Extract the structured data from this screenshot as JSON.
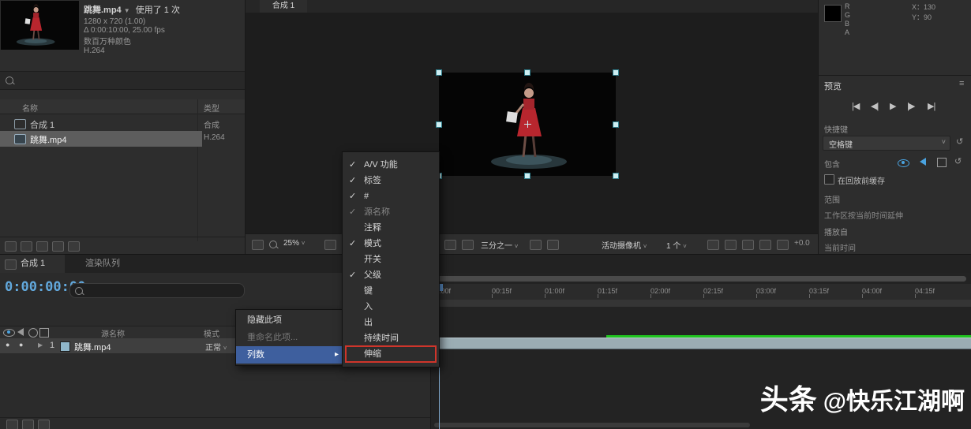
{
  "icons": {
    "check": "✓",
    "chevron_down": "˅",
    "dropdown_caret": "▼",
    "submenu_arrow": "▸",
    "panel_menu": "≡",
    "reset": "↺",
    "expander": "▶",
    "eye_dot": "●",
    "play": "▶",
    "to_start": "|◀",
    "step_back": "◀|",
    "step_fwd": "|▶",
    "to_end": "▶|"
  },
  "project": {
    "clip_name": "跳舞.mp4",
    "usage": "使用了 1 次",
    "info_line1": "1280 x 720 (1.00)",
    "info_line2": "Δ 0:00:10:00, 25.00 fps",
    "info_line3": "数百万种颜色",
    "info_line4": "H.264",
    "columns": {
      "name": "名称",
      "type": "类型"
    },
    "items": [
      {
        "name": "合成 1",
        "type": "合成"
      },
      {
        "name": "跳舞.mp4",
        "type": "H.264"
      }
    ]
  },
  "viewer": {
    "tab_label": "合成 1",
    "zoom": "25%",
    "resolution": "三分之一",
    "camera": "活动摄像机",
    "views": "1 个",
    "exposure": "+0.0"
  },
  "context_menu": {
    "hide_item": "隐藏此项",
    "rename_item": "重命名此项...",
    "columns_item": "列数"
  },
  "columns_menu": {
    "items": [
      {
        "label": "A/V 功能",
        "checked": true
      },
      {
        "label": "标签",
        "checked": true
      },
      {
        "label": "#",
        "checked": true
      },
      {
        "label": "源名称",
        "checked": true
      },
      {
        "label": "注释",
        "checked": false
      },
      {
        "label": "模式",
        "checked": true
      },
      {
        "label": "开关",
        "checked": false
      },
      {
        "label": "父级",
        "checked": true
      },
      {
        "label": "键",
        "checked": false
      },
      {
        "label": "入",
        "checked": false
      },
      {
        "label": "出",
        "checked": false
      },
      {
        "label": "持续时间",
        "checked": false
      },
      {
        "label": "伸缩",
        "checked": false,
        "annotated": true
      }
    ]
  },
  "timeline": {
    "tab_composition": "合成 1",
    "tab_render_queue": "渲染队列",
    "current_time": "0:00:00:00",
    "col_source": "源名称",
    "col_mode": "模式",
    "layer": {
      "index": "1",
      "name": "跳舞.mp4",
      "mode": "正常"
    },
    "ruler": [
      ":00f",
      "00:15f",
      "01:00f",
      "01:15f",
      "02:00f",
      "02:15f",
      "03:00f",
      "03:15f",
      "04:00f",
      "04:15f"
    ]
  },
  "info_panel": {
    "r": "R",
    "g": "G",
    "b": "B",
    "a": "A",
    "x_label": "X：",
    "x_value": "130",
    "y_label": "Y：",
    "y_value": "90"
  },
  "preview": {
    "title": "预览",
    "shortcut_label": "快捷键",
    "shortcut_value": "空格键",
    "include_label": "包含",
    "cache_checkbox": "在回放前缓存",
    "range_label": "范围",
    "range_value": "工作区按当前时间延伸",
    "play_from_label": "播放自",
    "play_from_value": "当前时间"
  },
  "watermark": {
    "brand": "头条",
    "handle": "@快乐江湖啊"
  },
  "colors": {
    "highlight_blue": "#3e5f9e",
    "render_green": "#1fc41f",
    "annotation_red": "#cf352b",
    "time_blue": "#62a8dc",
    "layer_label": "#8fb6c9"
  }
}
